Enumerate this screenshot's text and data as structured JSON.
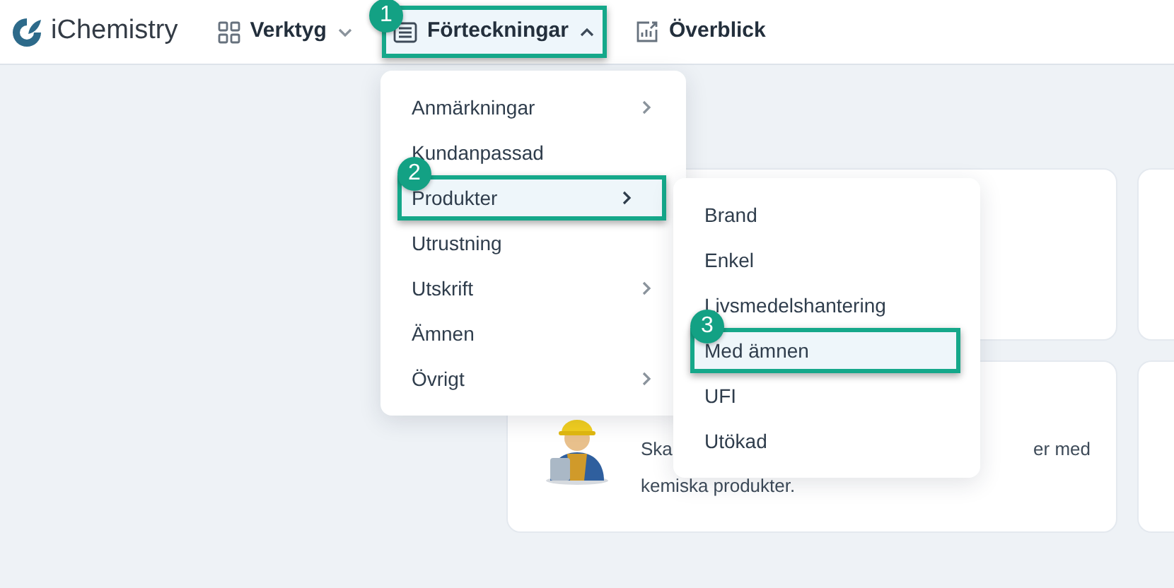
{
  "logo": "iChemistry",
  "nav": [
    {
      "label": "Verktyg",
      "dropdown": true,
      "expanded": false
    },
    {
      "label": "Förteckningar",
      "dropdown": true,
      "expanded": true,
      "callout": "1"
    },
    {
      "label": "Överblick",
      "dropdown": false,
      "expanded": false
    }
  ],
  "menu": [
    {
      "label": "Anmärkningar",
      "submenu": true,
      "selected": false
    },
    {
      "label": "Kundanpassad",
      "submenu": false,
      "selected": false
    },
    {
      "label": "Produkter",
      "submenu": true,
      "selected": true,
      "callout": "2"
    },
    {
      "label": "Utrustning",
      "submenu": false,
      "selected": false
    },
    {
      "label": "Utskrift",
      "submenu": true,
      "selected": false
    },
    {
      "label": "Ämnen",
      "submenu": false,
      "selected": false
    },
    {
      "label": "Övrigt",
      "submenu": true,
      "selected": false
    }
  ],
  "submenu": [
    {
      "label": "Brand",
      "selected": false
    },
    {
      "label": "Enkel",
      "selected": false
    },
    {
      "label": "Livsmedelshantering",
      "selected": false
    },
    {
      "label": "Med ämnen",
      "selected": true,
      "callout": "3"
    },
    {
      "label": "UFI",
      "selected": false
    },
    {
      "label": "Utökad",
      "selected": false
    }
  ],
  "card": {
    "text_start": "Ska",
    "text_end": "er med",
    "text_line_2": "kemiska produkter."
  }
}
